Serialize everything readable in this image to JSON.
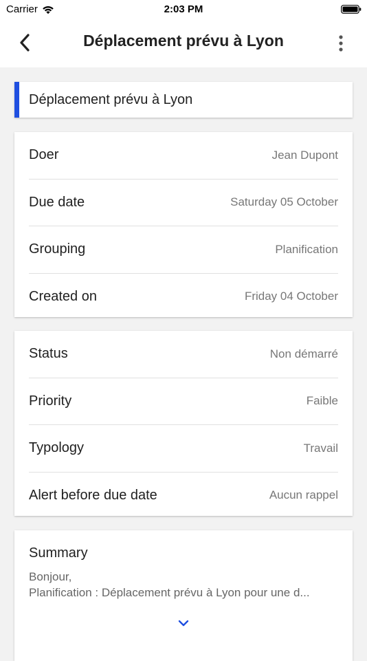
{
  "status_bar": {
    "carrier": "Carrier",
    "time": "2:03 PM",
    "icons": [
      "wifi-icon",
      "battery-icon"
    ]
  },
  "nav": {
    "title": "Déplacement prévu à Lyon",
    "back_icon": "chevron-left-icon",
    "more_icon": "more-vertical-icon"
  },
  "task": {
    "title": "Déplacement prévu à Lyon",
    "accent_color": "#1f4fe0"
  },
  "details": [
    {
      "label": "Doer",
      "value": "Jean Dupont"
    },
    {
      "label": "Due date",
      "value": "Saturday 05 October"
    },
    {
      "label": "Grouping",
      "value": "Planification"
    },
    {
      "label": "Created on",
      "value": "Friday 04 October"
    }
  ],
  "properties": [
    {
      "label": "Status",
      "value": "Non démarré"
    },
    {
      "label": "Priority",
      "value": "Faible"
    },
    {
      "label": "Typology",
      "value": "Travail"
    },
    {
      "label": "Alert before due date",
      "value": "Aucun rappel"
    }
  ],
  "summary": {
    "label": "Summary",
    "line1": "Bonjour,",
    "line2": "Planification : Déplacement prévu à Lyon pour une d...",
    "expand_icon": "chevron-down-icon"
  }
}
